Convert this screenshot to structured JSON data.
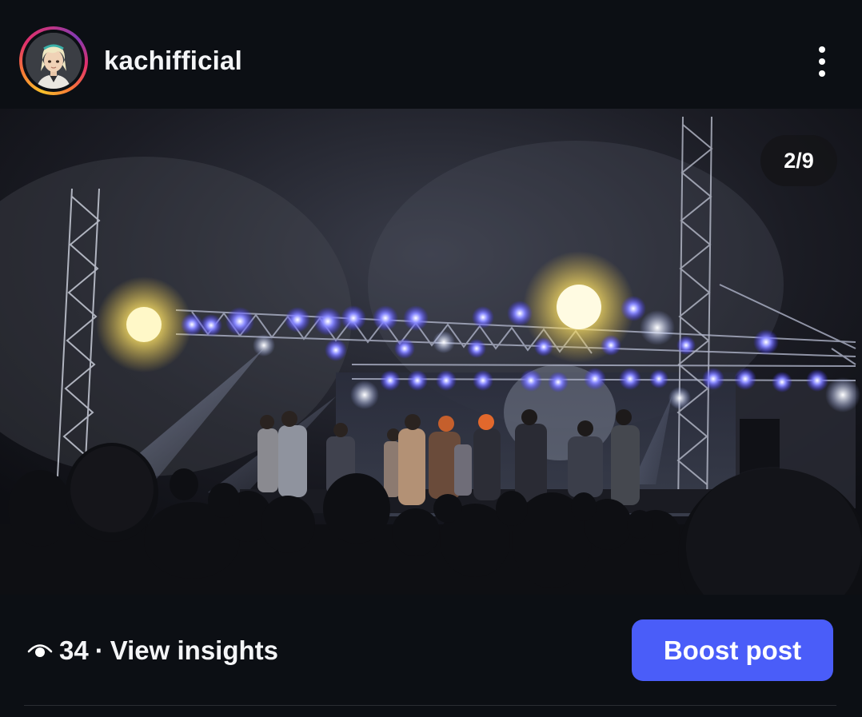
{
  "header": {
    "username": "kachifficial",
    "avatar_icon": "cartoon-avatar",
    "more_icon": "vertical-ellipsis-icon"
  },
  "photo": {
    "counter": "2/9",
    "subject": "concert-stage-photo"
  },
  "footer": {
    "views_icon": "eye-icon",
    "views_count": "34",
    "separator": "·",
    "insights_label": "View insights",
    "boost_label": "Boost post"
  },
  "colors": {
    "background": "#0c0f14",
    "boost_button": "#4a5df9",
    "text": "#f4f5f7"
  }
}
